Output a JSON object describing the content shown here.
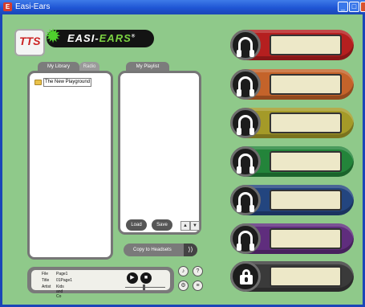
{
  "window": {
    "title": "Easi-Ears"
  },
  "logos": {
    "tts": "TTS",
    "brand_prefix": "EASI-",
    "brand_suffix": "EARS"
  },
  "library": {
    "tab_label": "My Library",
    "radio_tab_label": "Radio",
    "items": [
      {
        "label": "The New Playground"
      }
    ]
  },
  "playlist": {
    "tab_label": "My Playlist",
    "load_label": "Load",
    "save_label": "Save",
    "up_arrow": "▲",
    "down_arrow": "▼"
  },
  "copy": {
    "label": "Copy to Headsets",
    "arrow": "⟩⟩"
  },
  "player": {
    "file_key": "File",
    "file_value": "Page1",
    "title_key": "Title",
    "title_value": "01Page1",
    "artist_key": "Artist",
    "artist_value": "Kids and Co",
    "play_icon": "▶",
    "stop_icon": "■",
    "seek_position": 0.45
  },
  "side_buttons": {
    "music_icon": "♪",
    "help_icon": "?",
    "settings_icon": "⚙",
    "list_icon": "≡"
  },
  "headsets": [
    {
      "color": "#b51f1f",
      "label": ""
    },
    {
      "color": "#c4632a",
      "label": ""
    },
    {
      "color": "#a49a28",
      "label": ""
    },
    {
      "color": "#23843a",
      "label": ""
    },
    {
      "color": "#23457f",
      "label": ""
    },
    {
      "color": "#5f2d7d",
      "label": ""
    },
    {
      "color": "#3a3a3a",
      "label": "",
      "locked": true
    }
  ]
}
